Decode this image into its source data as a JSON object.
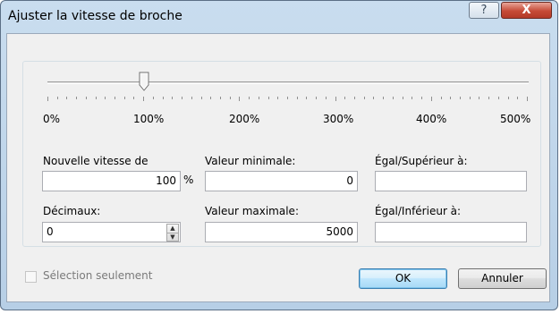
{
  "window": {
    "title": "Ajuster la vitesse de broche"
  },
  "titlebar": {
    "help_label": "?",
    "close_label": "X"
  },
  "slider": {
    "value_percent": 100,
    "min_percent": 0,
    "max_percent": 500,
    "tick_labels": [
      "0%",
      "100%",
      "200%",
      "300%",
      "400%",
      "500%"
    ]
  },
  "form": {
    "nouvelle_vitesse_label": "Nouvelle vitesse de",
    "nouvelle_vitesse_value": "100",
    "percent_unit": "%",
    "decimaux_label": "Décimaux:",
    "decimaux_value": "0",
    "valeur_min_label": "Valeur minimale:",
    "valeur_min_value": "0",
    "valeur_max_label": "Valeur maximale:",
    "valeur_max_value": "5000",
    "egal_superieur_label": "Égal/Supérieur à:",
    "egal_superieur_value": "",
    "egal_inferieur_label": "Égal/Inférieur à:",
    "egal_inferieur_value": ""
  },
  "footer": {
    "selection_label": "Sélection seulement",
    "selection_checked": false,
    "ok_label": "OK",
    "cancel_label": "Annuler"
  },
  "icons": {
    "spin_up": "spin-up-arrow-icon",
    "spin_down": "spin-down-arrow-icon"
  },
  "colors": {
    "title_bar": "#c4d9ee",
    "close_button": "#c64a36",
    "dialog_bg": "#f0f0f0"
  }
}
